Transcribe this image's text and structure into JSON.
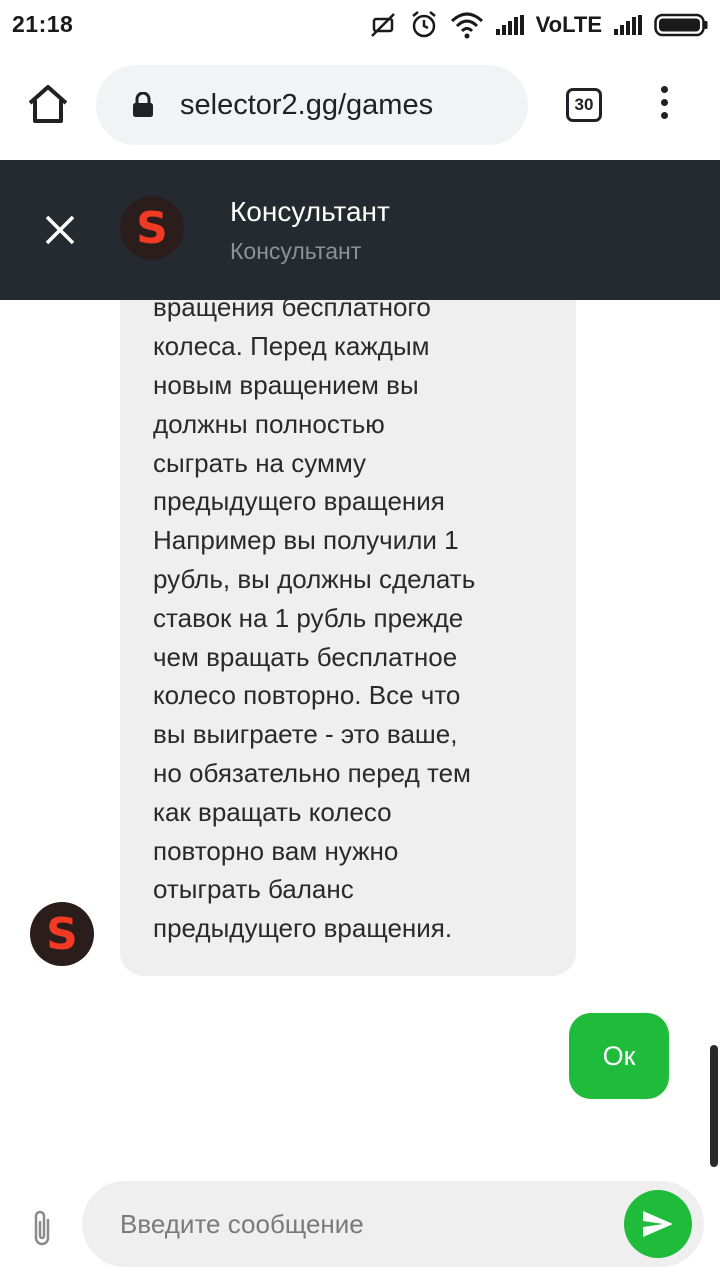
{
  "status_bar": {
    "time": "21:18",
    "network_label": "VoLTE",
    "icons": [
      "mute-icon",
      "alarm-icon",
      "wifi-icon",
      "signal-icon",
      "battery-icon"
    ]
  },
  "browser": {
    "url": "selector2.gg/games",
    "tab_count": "30",
    "icons": [
      "home-icon",
      "lock-icon",
      "tabs-icon",
      "menu-icon"
    ]
  },
  "chat": {
    "agent_name": "Консультант",
    "agent_role": "Консультант",
    "avatar_letter": "S",
    "messages": [
      {
        "direction": "incoming",
        "text": "вращения бесплатного\nколеса. Перед каждым\nновым вращением вы\nдолжны полностью\nсыграть на сумму\nпредыдущего вращения\nНапример вы получили 1\nрубль, вы должны сделать\nставок на 1 рубль прежде\nчем вращать бесплатное\nколесо повторно. Все что\nвы выиграете - это ваше,\nно обязательно перед тем\nкак вращать колесо\nповторно вам нужно\nотыграть баланс\nпредыдущего вращения."
      },
      {
        "direction": "outgoing",
        "text": "Ок"
      }
    ],
    "input_placeholder": "Введите сообщение"
  },
  "colors": {
    "header_bg": "#252a31",
    "accent_green": "#1fbb3a",
    "bubble_incoming": "#efefef",
    "avatar_letter": "#f03a24"
  }
}
